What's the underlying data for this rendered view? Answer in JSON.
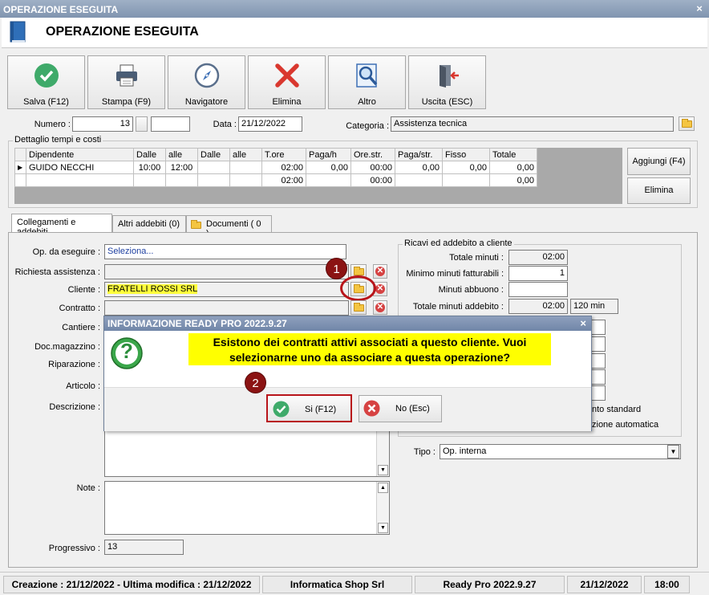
{
  "window": {
    "title": "OPERAZIONE ESEGUITA",
    "header_title": "OPERAZIONE ESEGUITA",
    "close_glyph": "×"
  },
  "toolbar": [
    {
      "name": "salva-button",
      "label": "Salva (F12)",
      "icon": "check-circle-icon"
    },
    {
      "name": "stampa-button",
      "label": "Stampa (F9)",
      "icon": "printer-icon"
    },
    {
      "name": "navigatore-button",
      "label": "Navigatore",
      "icon": "compass-icon"
    },
    {
      "name": "elimina-toolbar-button",
      "label": "Elimina",
      "icon": "red-x-icon"
    },
    {
      "name": "altro-button",
      "label": "Altro",
      "icon": "document-search-icon"
    },
    {
      "name": "uscita-button",
      "label": "Uscita (ESC)",
      "icon": "exit-door-icon"
    }
  ],
  "form_top": {
    "numero_label": "Numero :",
    "numero_value": "13",
    "data_label": "Data :",
    "data_value": "21/12/2022",
    "categoria_label": "Categoria :",
    "categoria_value": "Assistenza tecnica"
  },
  "dettaglio": {
    "title": "Dettaglio tempi e costi",
    "columns": [
      "Dipendente",
      "Dalle",
      "alle",
      "Dalle",
      "alle",
      "T.ore",
      "Paga/h",
      "Ore.str.",
      "Paga/str.",
      "Fisso",
      "Totale"
    ],
    "rows": [
      [
        "GUIDO NECCHI",
        "10:00",
        "12:00",
        "",
        "",
        "02:00",
        "0,00",
        "00:00",
        "0,00",
        "0,00",
        "0,00"
      ],
      [
        "",
        "",
        "",
        "",
        "",
        "02:00",
        "",
        "00:00",
        "",
        "",
        "0,00"
      ]
    ],
    "row_indicator": "▶",
    "aggiungi_label": "Aggiungi (F4)",
    "elimina_label": "Elimina"
  },
  "tabs": [
    {
      "label": "Collegamenti e addebiti",
      "active": true
    },
    {
      "label": "Altri addebiti (0)",
      "active": false
    },
    {
      "label": "Documenti ( 0 )",
      "active": false
    }
  ],
  "left_fields": {
    "op_label": "Op. da eseguire :",
    "op_value": "Seleziona...",
    "richiesta_label": "Richiesta assistenza :",
    "cliente_label": "Cliente :",
    "cliente_value": "FRATELLI ROSSI SRL",
    "contratto_label": "Contratto :",
    "cantiere_label": "Cantiere :",
    "docmag_label": "Doc.magazzino :",
    "riparazione_label": "Riparazione :",
    "articolo_label": "Articolo :",
    "descrizione_label": "Descrizione :",
    "note_label": "Note :",
    "progressivo_label": "Progressivo :",
    "progressivo_value": "13"
  },
  "ricavi": {
    "title": "Ricavi ed addebito a cliente",
    "totale_minuti_label": "Totale minuti :",
    "totale_minuti_value": "02:00",
    "minimo_label": "Minimo minuti fatturabili :",
    "minimo_value": "1",
    "abbuono_label": "Minuti abbuono :",
    "abbuono_value": "",
    "addebito_label": "Totale minuti addebito :",
    "addebito_value": "02:00",
    "addebito_min": "120 min",
    "partial_1": "nto standard",
    "partial_2": "zione automatica",
    "tipo_label": "Tipo :",
    "tipo_value": "Op. interna"
  },
  "dialog": {
    "title": "INFORMAZIONE READY PRO 2022.9.27",
    "close_glyph": "×",
    "question_glyph": "?",
    "message_line1": "Esistono dei contratti attivi associati a questo cliente. Vuoi",
    "message_line2": "selezionarne uno da associare a questa operazione?",
    "yes_label": "Si (F12)",
    "no_label": "No (Esc)"
  },
  "badges": {
    "one": "1",
    "two": "2"
  },
  "statusbar": {
    "creazione": "Creazione : 21/12/2022 - Ultima modifica : 21/12/2022",
    "company": "Informatica Shop Srl",
    "version": "Ready Pro 2022.9.27",
    "date": "21/12/2022",
    "time": "18:00"
  },
  "colors": {
    "highlight": "#ffff00",
    "badge": "#8b1313",
    "accent_green": "#3faa6a",
    "accent_red": "#d64242"
  }
}
